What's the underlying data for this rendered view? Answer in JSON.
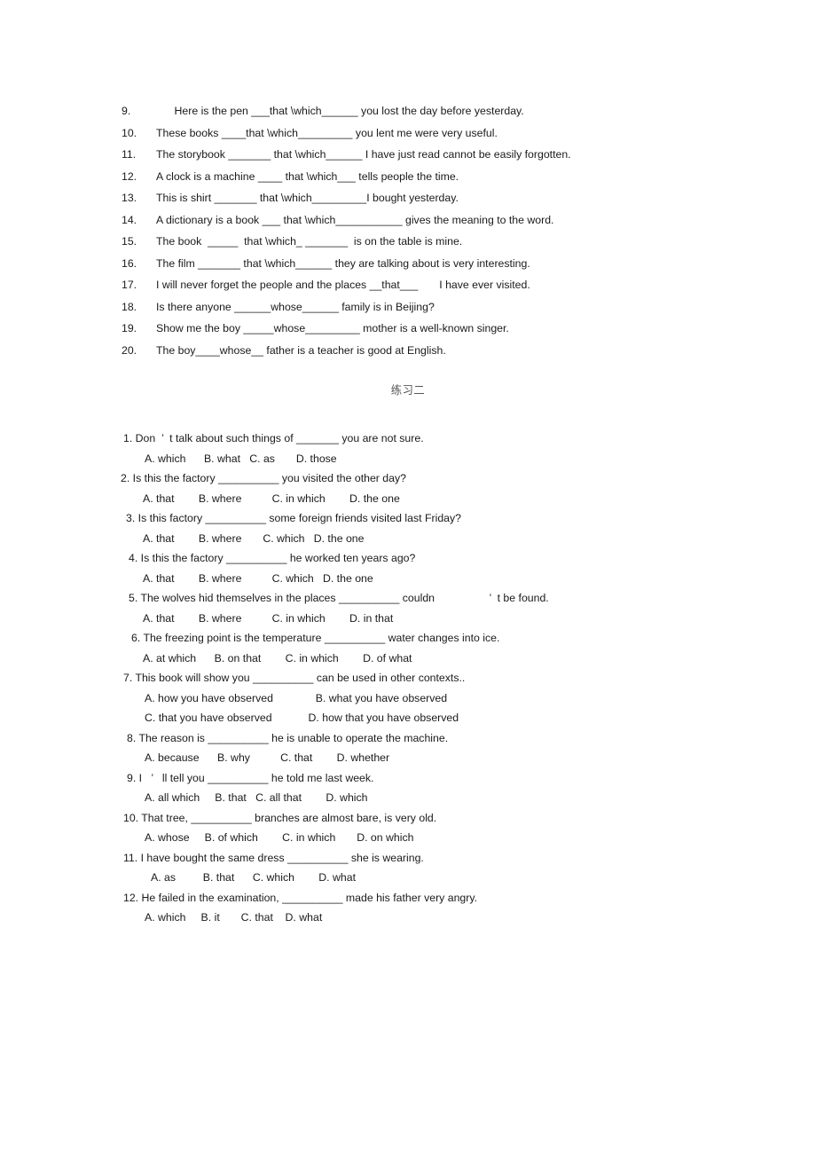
{
  "document": {
    "type": "grammar-worksheet",
    "section_heading": "练习二"
  },
  "fill_in_section": {
    "items": [
      {
        "number": "9.",
        "text": "      Here is the pen ___that \\which______ you lost the day before yesterday."
      },
      {
        "number": "10.",
        "text": "These books ____that \\which_________ you lent me were very useful."
      },
      {
        "number": "11.",
        "text": "The storybook _______ that \\which______ I have just read cannot be easily forgotten."
      },
      {
        "number": "12.",
        "text": "A clock is a machine ____ that \\which___ tells people the time."
      },
      {
        "number": "13.",
        "text": "This is shirt _______ that \\which_________I bought yesterday."
      },
      {
        "number": "14.",
        "text": "A dictionary is a book ___ that \\which___________ gives the meaning to the word."
      },
      {
        "number": "15.",
        "text": "The book  _____  that \\which_ _______  is on the table is mine."
      },
      {
        "number": "16.",
        "text": "The film _______ that \\which______ they are talking about is very interesting."
      },
      {
        "number": "17.",
        "text": "I will never forget the people and the places __that___       I have ever visited."
      },
      {
        "number": "18.",
        "text": "Is there anyone ______whose______ family is in Beijing?"
      },
      {
        "number": "19.",
        "text": "Show me the boy _____whose_________ mother is a well-known singer."
      },
      {
        "number": "20.",
        "text": "The boy____whose__ father is a teacher is good at English."
      }
    ]
  },
  "mcq_section": {
    "questions": [
      {
        "stem": "1. Don  ’  t talk about such things of _______ you are not sure.",
        "stem_indent": 139,
        "option_lines": [
          {
            "text": "A. which      B. what   C. as       D. those",
            "indent": 163
          }
        ]
      },
      {
        "stem": "2. Is this the factory __________ you visited the other day?",
        "stem_indent": 136,
        "option_lines": [
          {
            "text": "A. that        B. where          C. in which        D. the one",
            "indent": 161
          }
        ]
      },
      {
        "stem": "3. Is this factory __________ some foreign friends visited last Friday?",
        "stem_indent": 142,
        "option_lines": [
          {
            "text": "A. that        B. where       C. which   D. the one",
            "indent": 161
          }
        ]
      },
      {
        "stem": "4. Is this the factory __________ he worked ten years ago?",
        "stem_indent": 145,
        "option_lines": [
          {
            "text": "A. that        B. where          C. which   D. the one",
            "indent": 161
          }
        ]
      },
      {
        "stem": "5. The wolves hid themselves in the places __________ couldn                  ’  t be found.",
        "stem_indent": 145,
        "option_lines": [
          {
            "text": "A. that        B. where          C. in which        D. in that",
            "indent": 161
          }
        ]
      },
      {
        "stem": "6. The freezing point is the temperature __________ water changes into ice.",
        "stem_indent": 148,
        "option_lines": [
          {
            "text": "A. at which      B. on that        C. in which        D. of what",
            "indent": 161
          }
        ]
      },
      {
        "stem": "7. This book will show you __________ can be used in other contexts..",
        "stem_indent": 139,
        "option_lines": [
          {
            "text": "A. how you have observed              B. what you have observed",
            "indent": 163
          },
          {
            "text": "C. that you have observed            D. how that you have observed",
            "indent": 163
          }
        ]
      },
      {
        "stem": "8. The reason is __________ he is unable to operate the machine.",
        "stem_indent": 143,
        "option_lines": [
          {
            "text": "A. because      B. why          C. that        D. whether",
            "indent": 163
          }
        ]
      },
      {
        "stem": "9. I   ’   ll tell you __________ he told me last week.",
        "stem_indent": 143,
        "option_lines": [
          {
            "text": "A. all which     B. that   C. all that        D. which",
            "indent": 163
          }
        ]
      },
      {
        "stem": "10. That tree, __________ branches are almost bare, is very old.",
        "stem_indent": 139,
        "option_lines": [
          {
            "text": "A. whose     B. of which        C. in which       D. on which",
            "indent": 163
          }
        ]
      },
      {
        "stem": "11. I have bought the same dress __________ she is wearing.",
        "stem_indent": 139,
        "option_lines": [
          {
            "text": "A. as         B. that      C. which        D. what",
            "indent": 170
          }
        ]
      },
      {
        "stem": "12. He failed in the examination, __________ made his father very angry.",
        "stem_indent": 139,
        "option_lines": [
          {
            "text": "A. which     B. it       C. that    D. what",
            "indent": 163
          }
        ]
      }
    ]
  }
}
